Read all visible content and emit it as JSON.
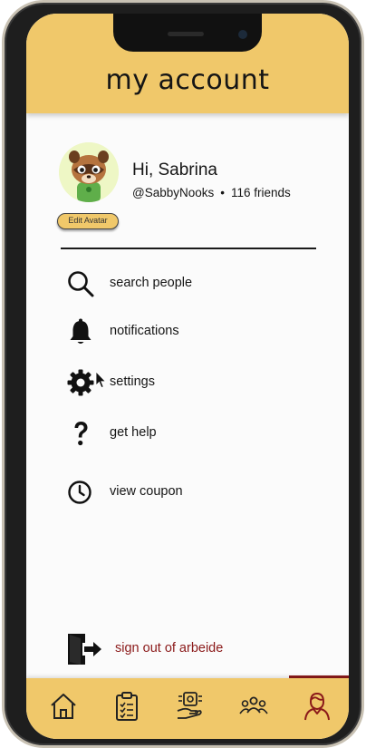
{
  "header": {
    "title": "my account"
  },
  "profile": {
    "greeting": "Hi, Sabrina",
    "handle": "@SabbyNooks",
    "separator": "•",
    "friends": "116 friends",
    "edit_avatar_label": "Edit Avatar"
  },
  "menu": [
    {
      "label": "search people",
      "icon": "search-icon"
    },
    {
      "label": "notifications",
      "icon": "bell-icon"
    },
    {
      "label": "settings",
      "icon": "gear-icon"
    },
    {
      "label": "get help",
      "icon": "question-icon"
    },
    {
      "label": "view coupon",
      "icon": "clock-icon"
    }
  ],
  "signout": {
    "label": "sign out of arbeide",
    "icon": "sign-out-icon",
    "color": "#8b1a1a"
  },
  "tabbar": {
    "tabs": [
      "home-icon",
      "clipboard-icon",
      "hand-badge-icon",
      "group-icon",
      "profile-icon"
    ],
    "active_tab": "profile-icon"
  },
  "colors": {
    "accent": "#f0c86a",
    "signout": "#8b1a1a",
    "text": "#151515"
  }
}
